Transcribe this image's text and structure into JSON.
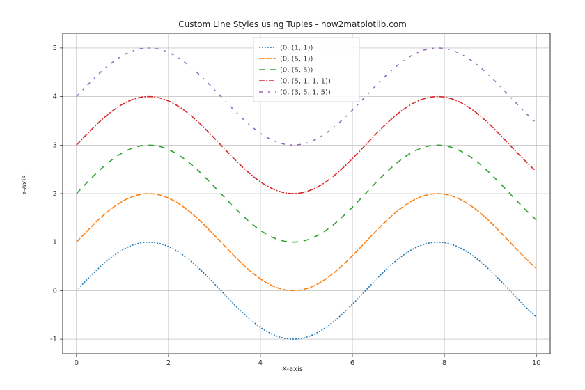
{
  "chart_data": {
    "type": "line",
    "title": "Custom Line Styles using Tuples - how2matplotlib.com",
    "xlabel": "X-axis",
    "ylabel": "Y-axis",
    "xlim": [
      -0.3,
      10.3
    ],
    "ylim": [
      -1.3,
      5.3
    ],
    "xticks": [
      0,
      2,
      4,
      6,
      8,
      10
    ],
    "yticks": [
      -1,
      0,
      1,
      2,
      3,
      4,
      5
    ],
    "function": "y = sin(x) + i",
    "x_samples": 100,
    "x_range": [
      0,
      10
    ],
    "series": [
      {
        "name": "(0, (1, 1))",
        "offset": 0,
        "color": "#1f77b4",
        "dash": "2,2"
      },
      {
        "name": "(0, (5, 1))",
        "offset": 1,
        "color": "#ff7f0e",
        "dash": "8,2"
      },
      {
        "name": "(0, (5, 5))",
        "offset": 2,
        "color": "#2ca02c",
        "dash": "8,8"
      },
      {
        "name": "(0, (5, 1, 1, 1))",
        "offset": 3,
        "color": "#d62728",
        "dash": "8,2,2,2"
      },
      {
        "name": "(0, (3, 5, 1, 5))",
        "offset": 4,
        "color": "#9467bd",
        "dash": "5,8,2,8"
      }
    ],
    "legend": {
      "position": "top-center"
    }
  }
}
